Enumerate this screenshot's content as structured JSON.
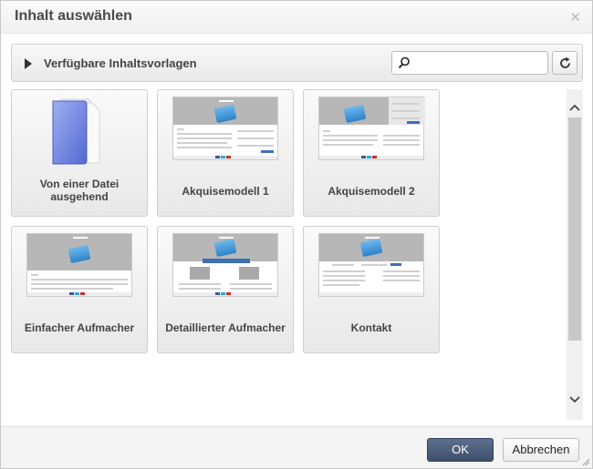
{
  "dialog": {
    "title": "Inhalt auswählen",
    "close_icon": "close-icon"
  },
  "section": {
    "title": "Verfügbare Inhaltsvorlagen",
    "search_value": "",
    "search_icon": "search-icon",
    "refresh_icon": "refresh-icon"
  },
  "templates": [
    {
      "label": "Von einer Datei\nausgehend",
      "icon": "folder-icon"
    },
    {
      "label": "Akquisemodell 1",
      "icon": "template-thumbnail"
    },
    {
      "label": "Akquisemodell 2",
      "icon": "template-thumbnail"
    },
    {
      "label": "Einfacher Aufmacher",
      "icon": "template-thumbnail"
    },
    {
      "label": "Detaillierter Aufmacher",
      "icon": "template-thumbnail"
    },
    {
      "label": "Kontakt",
      "icon": "template-thumbnail"
    }
  ],
  "footer": {
    "ok_label": "OK",
    "cancel_label": "Abbrechen"
  },
  "colors": {
    "ok_button": "#4a5b78",
    "folder": "#6f84e0"
  }
}
